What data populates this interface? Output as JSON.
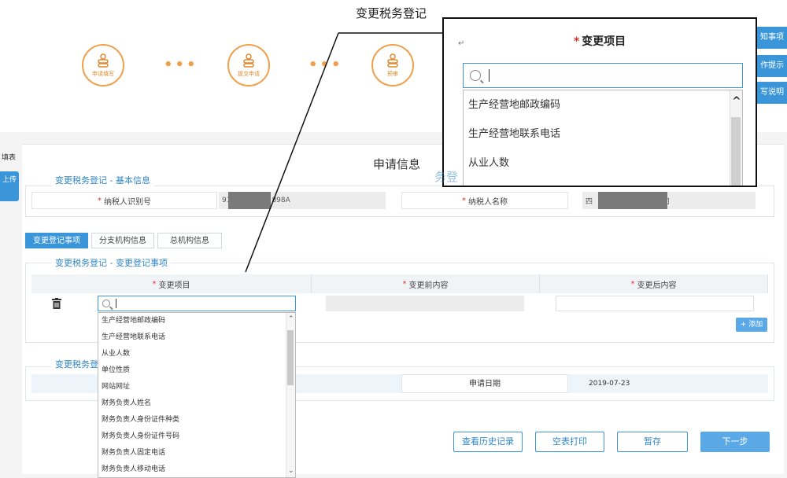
{
  "annotation": {
    "title": "变更税务登记"
  },
  "steps": [
    {
      "label": "申请填写"
    },
    {
      "label": "提交申请"
    },
    {
      "label": "预审"
    }
  ],
  "right_tabs": [
    "知事项",
    "作提示",
    "写说明"
  ],
  "side": {
    "fill_label": "填表",
    "upload_label": "上传"
  },
  "page": {
    "heading": "申请信息"
  },
  "basic_info": {
    "section_title": "变更税务登记 - 基本信息",
    "taxpayer_id_label": "纳税人识别号",
    "taxpayer_id_prefix": "91",
    "taxpayer_id_suffix": "898A",
    "taxpayer_name_label": "纳税人名称",
    "taxpayer_name_prefix": "四",
    "taxpayer_name_suffix": "公司"
  },
  "tabs": [
    {
      "label": "变更登记事项",
      "active": true
    },
    {
      "label": "分支机构信息",
      "active": false
    },
    {
      "label": "总机构信息",
      "active": false
    }
  ],
  "change_items": {
    "section_title": "变更税务登记 - 变更登记事项",
    "columns": [
      "变更项目",
      "变更前内容",
      "变更后内容"
    ],
    "add_button": "+ 添加"
  },
  "dropdown_options": [
    "生产经营地邮政编码",
    "生产经营地联系电话",
    "从业人数",
    "单位性质",
    "网站网址",
    "财务负责人姓名",
    "财务负责人身份证件种类",
    "财务负责人身份证件号码",
    "财务负责人固定电话",
    "财务负责人移动电话"
  ],
  "other_section": {
    "section_title": "变更税务登",
    "date_label": "申请日期",
    "date_value": "2019-07-23"
  },
  "buttons": {
    "history": "查看历史记录",
    "print": "空表打印",
    "save": "暂存",
    "next": "下一步"
  },
  "zoom": {
    "enter_mark": "↵",
    "heading": "变更项目",
    "options": [
      "生产经营地邮政编码",
      "生产经营地联系电话",
      "从业人数",
      "单位性质"
    ],
    "background_fragment": "务登"
  },
  "colors": {
    "accent": "#3a96d8",
    "step_orange": "#f0a04b",
    "required": "#d9342b"
  }
}
